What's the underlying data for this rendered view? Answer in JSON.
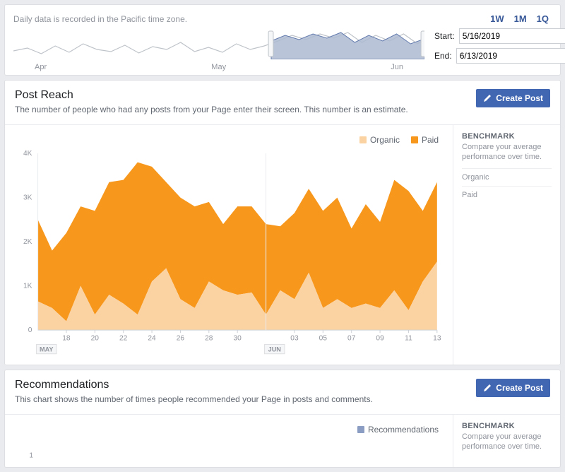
{
  "date_panel": {
    "tz_note": "Daily data is recorded in the Pacific time zone.",
    "ranges": [
      "1W",
      "1M",
      "1Q"
    ],
    "months": [
      "Apr",
      "May",
      "Jun"
    ],
    "start_label": "Start:",
    "end_label": "End:",
    "start_value": "5/16/2019",
    "end_value": "6/13/2019"
  },
  "post_reach": {
    "title": "Post Reach",
    "desc": "The number of people who had any posts from your Page enter their screen. This number is an estimate.",
    "create_label": "Create Post",
    "legend_organic": "Organic",
    "legend_paid": "Paid",
    "benchmark_title": "BENCHMARK",
    "benchmark_desc": "Compare your average performance over time.",
    "benchmark_organic": "Organic",
    "benchmark_paid": "Paid",
    "month_may": "MAY",
    "month_jun": "JUN"
  },
  "recommendations": {
    "title": "Recommendations",
    "desc": "This chart shows the number of times people recommended your Page in posts and comments.",
    "create_label": "Create Post",
    "legend": "Recommendations",
    "benchmark_title": "BENCHMARK",
    "benchmark_desc": "Compare your average performance over time."
  },
  "chart_data": {
    "type": "area",
    "title": "Post Reach",
    "xlabel": "",
    "ylabel": "",
    "ylim": [
      0,
      4000
    ],
    "x": [
      "16",
      "17",
      "18",
      "19",
      "20",
      "21",
      "22",
      "23",
      "24",
      "25",
      "26",
      "27",
      "28",
      "29",
      "30",
      "31",
      "01",
      "02",
      "03",
      "04",
      "05",
      "06",
      "07",
      "08",
      "09",
      "10",
      "11",
      "12",
      "13"
    ],
    "x_ticks": [
      "18",
      "20",
      "22",
      "24",
      "26",
      "28",
      "30",
      "03",
      "05",
      "07",
      "09",
      "11",
      "13"
    ],
    "y_ticks": [
      "0",
      "1K",
      "2K",
      "3K",
      "4K"
    ],
    "series": [
      {
        "name": "Organic",
        "color": "#fbd2a2",
        "values": [
          650,
          500,
          200,
          1000,
          350,
          800,
          600,
          350,
          1100,
          1400,
          700,
          500,
          1100,
          900,
          800,
          850,
          350,
          900,
          700,
          1300,
          500,
          700,
          500,
          600,
          500,
          900,
          450,
          1100,
          1550
        ]
      },
      {
        "name": "Paid",
        "color": "#f7981d",
        "values": [
          2500,
          1800,
          2200,
          2800,
          2700,
          3350,
          3400,
          3800,
          3700,
          3350,
          3000,
          2800,
          2900,
          2400,
          2800,
          2800,
          2400,
          2350,
          2650,
          3200,
          2700,
          3000,
          2300,
          2850,
          2450,
          3400,
          3150,
          2700,
          3350
        ]
      }
    ]
  },
  "colors": {
    "organic": "#fbd2a2",
    "paid": "#f7981d",
    "rec": "#8b9dc3",
    "overview_fill": "#adbad1",
    "overview_stroke": "#627aad"
  }
}
